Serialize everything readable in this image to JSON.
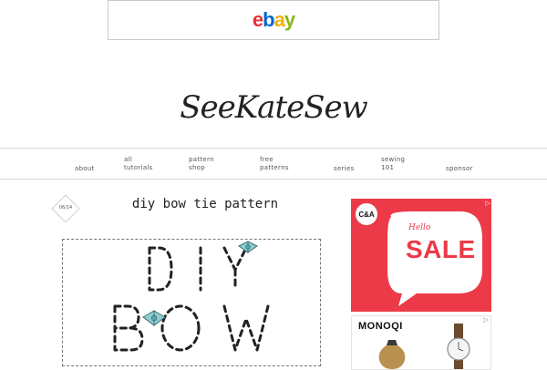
{
  "banner": {
    "logo_e": "e",
    "logo_b": "b",
    "logo_a": "a",
    "logo_y": "y",
    "colors": {
      "e": "#e53238",
      "b": "#0064d2",
      "a": "#f5af02",
      "y": "#86b817"
    }
  },
  "site": {
    "logo_text": "SeeKateSew"
  },
  "nav": {
    "items": [
      {
        "label": "about"
      },
      {
        "label": "all\ntutorials"
      },
      {
        "label": "pattern\nshop"
      },
      {
        "label": "free\npatterns"
      },
      {
        "label": "series"
      },
      {
        "label": "sewing\n101"
      },
      {
        "label": "sponsor"
      }
    ]
  },
  "post": {
    "date": "06/14",
    "title": "diy bow tie pattern",
    "image": {
      "line1": "DIY",
      "line2": "BOW"
    }
  },
  "ads": {
    "ca": {
      "logo": "C&A",
      "hello": "Hello",
      "sale": "SALE",
      "background": "#ec3a48"
    },
    "monoqi": {
      "brand": "MONOQI"
    }
  }
}
